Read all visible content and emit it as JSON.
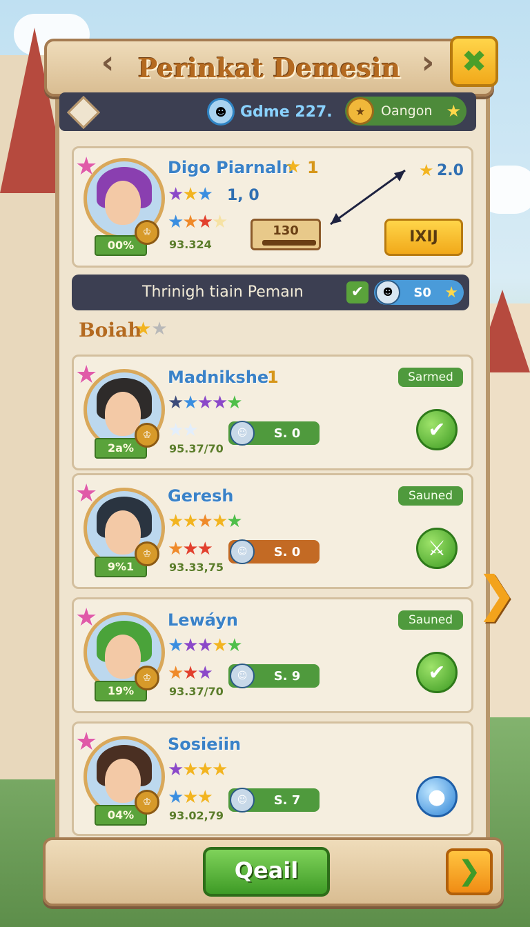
{
  "header": {
    "title": "Perinkat Demesin"
  },
  "topbar": {
    "game_label": "Gdme 227.",
    "currency_label": "Oangon"
  },
  "featured": {
    "name": "Digo Piarnaln",
    "rank": "1",
    "rating": "1, 0",
    "top_right_score": "2.0",
    "bar_value": "130",
    "score": "93.324",
    "percent": "00%",
    "action_label": "IXIJ",
    "colors": {
      "name": "#3a82c8",
      "hair": "#8a3fb0"
    }
  },
  "sub_bar": {
    "label": "Thrinigh tiain Pemaın",
    "pill_value": "S0"
  },
  "section": {
    "label": "Boiah"
  },
  "players": [
    {
      "name": "Madnikshe",
      "rank": "1",
      "percent": "2a%",
      "score": "95.37/70",
      "pill_value": "S. 0",
      "status": "Sarmed",
      "pill_color": "#4f9a3d",
      "hair": "#2e2b2a",
      "button_icon": "check-icon"
    },
    {
      "name": "Geresh",
      "rank": "",
      "percent": "9%1",
      "score": "93.33,75",
      "pill_value": "S. 0",
      "status": "Sauned",
      "pill_color": "#c36a24",
      "hair": "#2a3440",
      "button_icon": "sword-icon"
    },
    {
      "name": "Lewáyn",
      "rank": "",
      "percent": "19%",
      "score": "93.37/70",
      "pill_value": "S. 9",
      "status": "Sauned",
      "pill_color": "#4f9a3d",
      "hair": "#4aa33a",
      "button_icon": "check-icon"
    },
    {
      "name": "Sosieiin",
      "rank": "",
      "percent": "04%",
      "score": "93.02,79",
      "pill_value": "S. 7",
      "status": "",
      "pill_color": "#4f9a3d",
      "hair": "#4a2f22",
      "button_icon": "orb-icon"
    }
  ],
  "footer": {
    "main_button": "Qeail"
  }
}
